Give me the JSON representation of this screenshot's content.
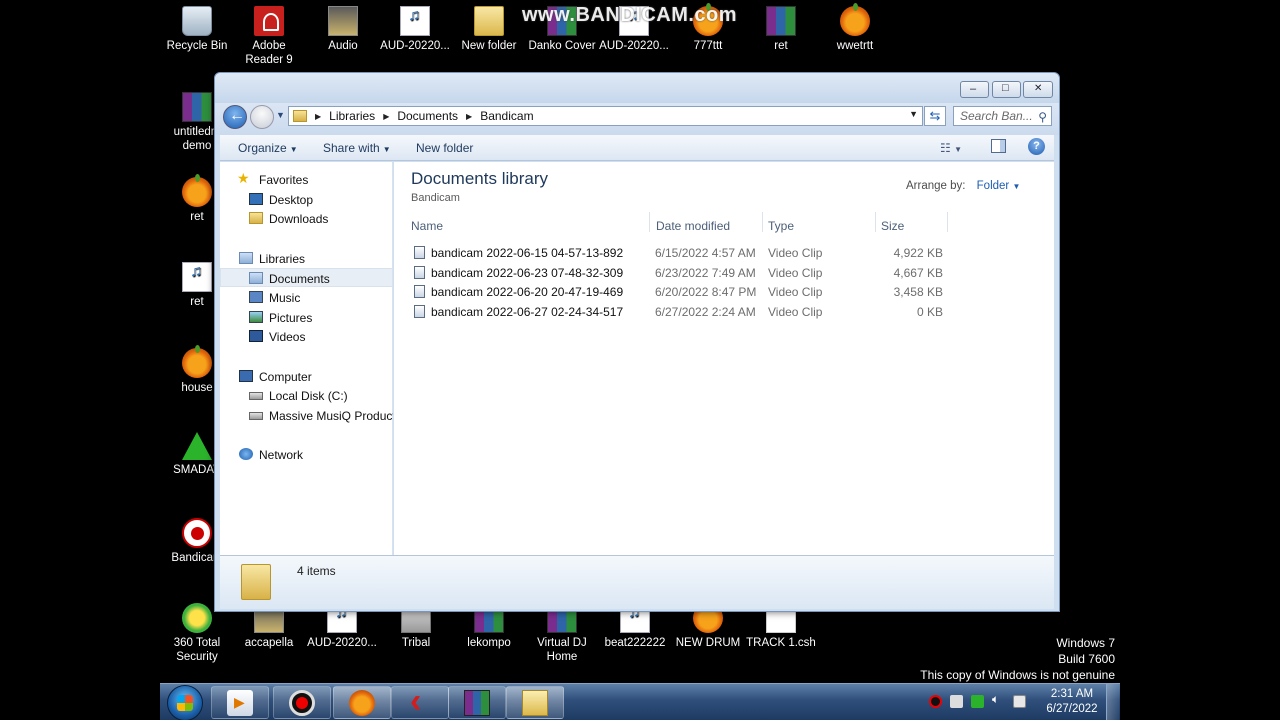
{
  "watermark": "www.BANDICAM.com",
  "desktop_top_icons": [
    {
      "label": "Recycle Bin",
      "icon": "recycle-bin-icon"
    },
    {
      "label": "Adobe Reader 9",
      "icon": "pdf-icon"
    },
    {
      "label": "Audio",
      "icon": "folder-icon"
    },
    {
      "label": "AUD-20220...",
      "icon": "mp3-icon"
    },
    {
      "label": "New folder",
      "icon": "folder-icon"
    },
    {
      "label": "Danko Cover",
      "icon": "winrar-icon"
    },
    {
      "label": "AUD-20220...",
      "icon": "mp3-icon"
    },
    {
      "label": "777ttt",
      "icon": "fl-studio-icon"
    },
    {
      "label": "ret",
      "icon": "winrar-icon"
    },
    {
      "label": "wwetrtt",
      "icon": "fl-studio-icon"
    }
  ],
  "desktop_left_icons": [
    {
      "label": "untitledm demo",
      "icon": "winrar-icon"
    },
    {
      "label": "ret",
      "icon": "fl-studio-icon"
    },
    {
      "label": "ret",
      "icon": "mp3-icon"
    },
    {
      "label": "house",
      "icon": "fl-studio-icon"
    },
    {
      "label": "SMADAV",
      "icon": "smadav-icon"
    },
    {
      "label": "Bandicam",
      "icon": "bandicam-icon"
    }
  ],
  "desktop_bottom_icons": [
    {
      "label": "360 Total Security",
      "icon": "360-security-icon"
    },
    {
      "label": "accapella",
      "icon": "folder-icon"
    },
    {
      "label": "AUD-20220...",
      "icon": "mp3-icon"
    },
    {
      "label": "Tribal",
      "icon": "folder-icon"
    },
    {
      "label": "lekompo",
      "icon": "winrar-icon"
    },
    {
      "label": "Virtual DJ Home",
      "icon": "winrar-icon"
    },
    {
      "label": "beat222222",
      "icon": "mp3-icon"
    },
    {
      "label": "NEW DRUM",
      "icon": "fl-studio-icon"
    },
    {
      "label": "TRACK 1.csh",
      "icon": "file-icon"
    }
  ],
  "windows_notice": {
    "line1": "Windows 7",
    "line2": "Build 7600",
    "line3": "This copy of Windows is not genuine"
  },
  "explorer": {
    "caption_buttons": {
      "minimize": "–",
      "maximize": "□",
      "close": "✕"
    },
    "breadcrumb": [
      "Libraries",
      "Documents",
      "Bandicam"
    ],
    "search_placeholder": "Search Ban...",
    "toolbar": {
      "organize": "Organize",
      "share_with": "Share with",
      "new_folder": "New folder"
    },
    "nav": {
      "favorites": "Favorites",
      "desktop": "Desktop",
      "downloads": "Downloads",
      "libraries": "Libraries",
      "documents": "Documents",
      "music": "Music",
      "pictures": "Pictures",
      "videos": "Videos",
      "computer": "Computer",
      "local_disk": "Local Disk (C:)",
      "massive": "Massive MusiQ Productio",
      "network": "Network"
    },
    "library_title": "Documents library",
    "library_subtitle": "Bandicam",
    "arrange_by_label": "Arrange by:",
    "arrange_by_value": "Folder",
    "columns": {
      "name": "Name",
      "date": "Date modified",
      "type": "Type",
      "size": "Size"
    },
    "files": [
      {
        "name": "bandicam 2022-06-15 04-57-13-892",
        "date": "6/15/2022 4:57 AM",
        "type": "Video Clip",
        "size": "4,922 KB"
      },
      {
        "name": "bandicam 2022-06-23 07-48-32-309",
        "date": "6/23/2022 7:49 AM",
        "type": "Video Clip",
        "size": "4,667 KB"
      },
      {
        "name": "bandicam 2022-06-20 20-47-19-469",
        "date": "6/20/2022 8:47 PM",
        "type": "Video Clip",
        "size": "3,458 KB"
      },
      {
        "name": "bandicam 2022-06-27 02-24-34-517",
        "date": "6/27/2022 2:24 AM",
        "type": "Video Clip",
        "size": "0 KB"
      }
    ],
    "item_count": "4 items"
  },
  "taskbar": {
    "time": "2:31 AM",
    "date": "6/27/2022"
  }
}
